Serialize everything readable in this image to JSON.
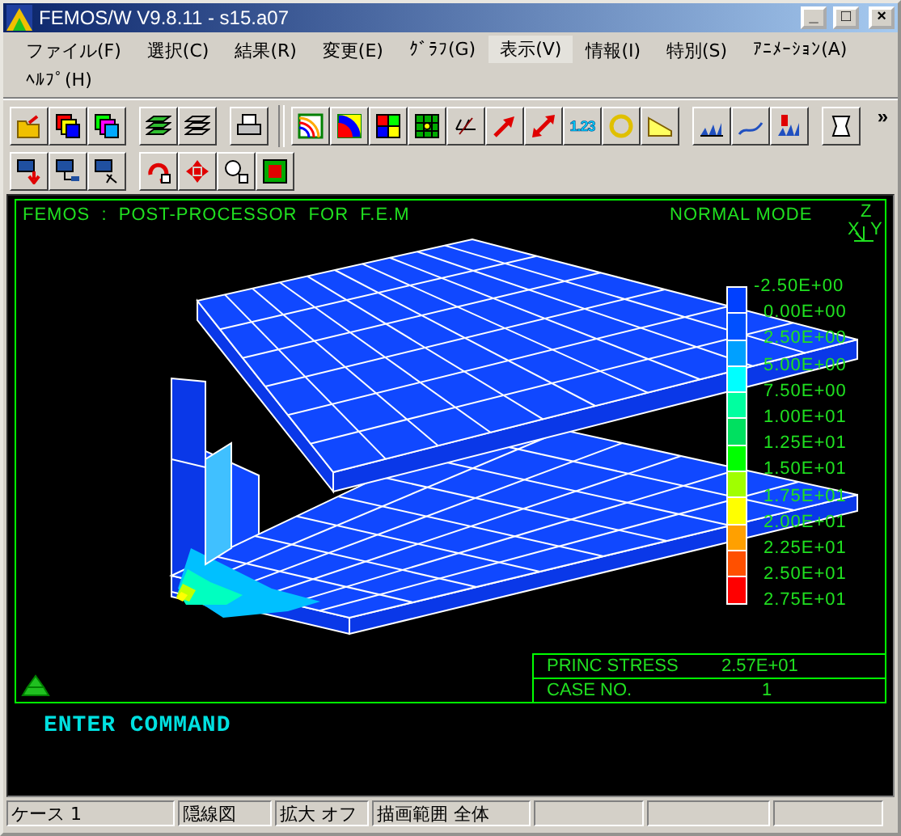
{
  "window": {
    "title": "FEMOS/W V9.8.11 - s15.a07",
    "controls": [
      "_",
      "□",
      "×"
    ]
  },
  "menu": [
    {
      "label": "ファイル(F)",
      "selected": false
    },
    {
      "label": "選択(C)",
      "selected": false
    },
    {
      "label": "結果(R)",
      "selected": false
    },
    {
      "label": "変更(E)",
      "selected": false
    },
    {
      "label": "ｸﾞﾗﾌ(G)",
      "selected": false
    },
    {
      "label": "表示(V)",
      "selected": true
    },
    {
      "label": "情報(I)",
      "selected": false
    },
    {
      "label": "特別(S)",
      "selected": false
    },
    {
      "label": "ｱﾆﾒｰｼｮﾝ(A)",
      "selected": false
    },
    {
      "label": "ﾍﾙﾌﾟ(H)",
      "selected": false
    }
  ],
  "toolbar": {
    "value_button_label": "1.23",
    "overflow": "»"
  },
  "viewport": {
    "header": "FEMOS  :  POST-PROCESSOR  FOR  F.E.M",
    "mode": "NORMAL MODE",
    "axes": {
      "z": "Z",
      "x": "X",
      "y": "Y"
    },
    "legend": {
      "labels": [
        "-2.50E+00",
        "0.00E+00",
        "2.50E+00",
        "5.00E+00",
        "7.50E+00",
        "1.00E+01",
        "1.25E+01",
        "1.50E+01",
        "1.75E+01",
        "2.00E+01",
        "2.25E+01",
        "2.50E+01",
        "2.75E+01"
      ],
      "bands": [
        {
          "color": "#0040ff"
        },
        {
          "color": "#0050ff"
        },
        {
          "color": "#00a0ff"
        },
        {
          "color": "#00ffff"
        },
        {
          "color": "#00ffa0"
        },
        {
          "color": "#00e060"
        },
        {
          "color": "#00ff00"
        },
        {
          "color": "#a0ff00"
        },
        {
          "color": "#ffff00"
        },
        {
          "color": "#ffa000"
        },
        {
          "color": "#ff5000"
        },
        {
          "color": "#ff0000"
        }
      ]
    },
    "result": [
      {
        "label": "PRINC STRESS",
        "value": "2.57E+01"
      },
      {
        "label": "CASE NO.",
        "value": "1"
      }
    ]
  },
  "command": "ENTER COMMAND",
  "status_bar": [
    "ケース 1",
    "隠線図",
    "拡大 オフ",
    "描画範囲 全体"
  ]
}
